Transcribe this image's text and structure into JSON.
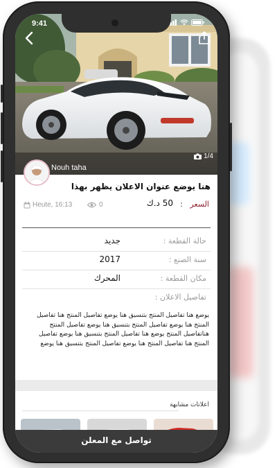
{
  "status_bar": {
    "time": "9:41"
  },
  "ad": {
    "photo_counter": "1/4",
    "seller_name": "Nouh taha",
    "title": "هنا يوضع عنوان الاعلان يظهر بهذا",
    "price_label": "السعر",
    "price_separator": ":",
    "price_value": "50 د.ك",
    "posted_time": "Heute, 16:13",
    "views": "0"
  },
  "details": [
    {
      "label": "حالة القطعة :",
      "value": "جديد"
    },
    {
      "label": "سنة الصنع :",
      "value": "2017"
    },
    {
      "label": "مكان القطعة :",
      "value": "المحرك"
    },
    {
      "label": "تفاصيل الاعلان :",
      "value": ""
    }
  ],
  "description": "يوضع هنا تفاصيل المنتج بتنسيق هنا يوضع تفاصيل المنتج هنا تفاصيل المنتج هنا يوضع تفاصيل المنتج بتنسيق هنا يوضع تفاصيل المنتج هناتفاصيل المنتج يوضع هنا تفاصيل المنتج بتنسيق هنا يوضع تفاصيل المنتج هنا تفاصيل المنتج هنا يوضع تفاصيل المنتج بتنسيق هنا يوضع",
  "similar": {
    "title": "اعلانات مشابهة"
  },
  "contact_button": "تواصل مع المعلن",
  "colors": {
    "accent": "#8e1f2e",
    "bar": "#3b3b3b",
    "frame": "#2f2f2f"
  }
}
